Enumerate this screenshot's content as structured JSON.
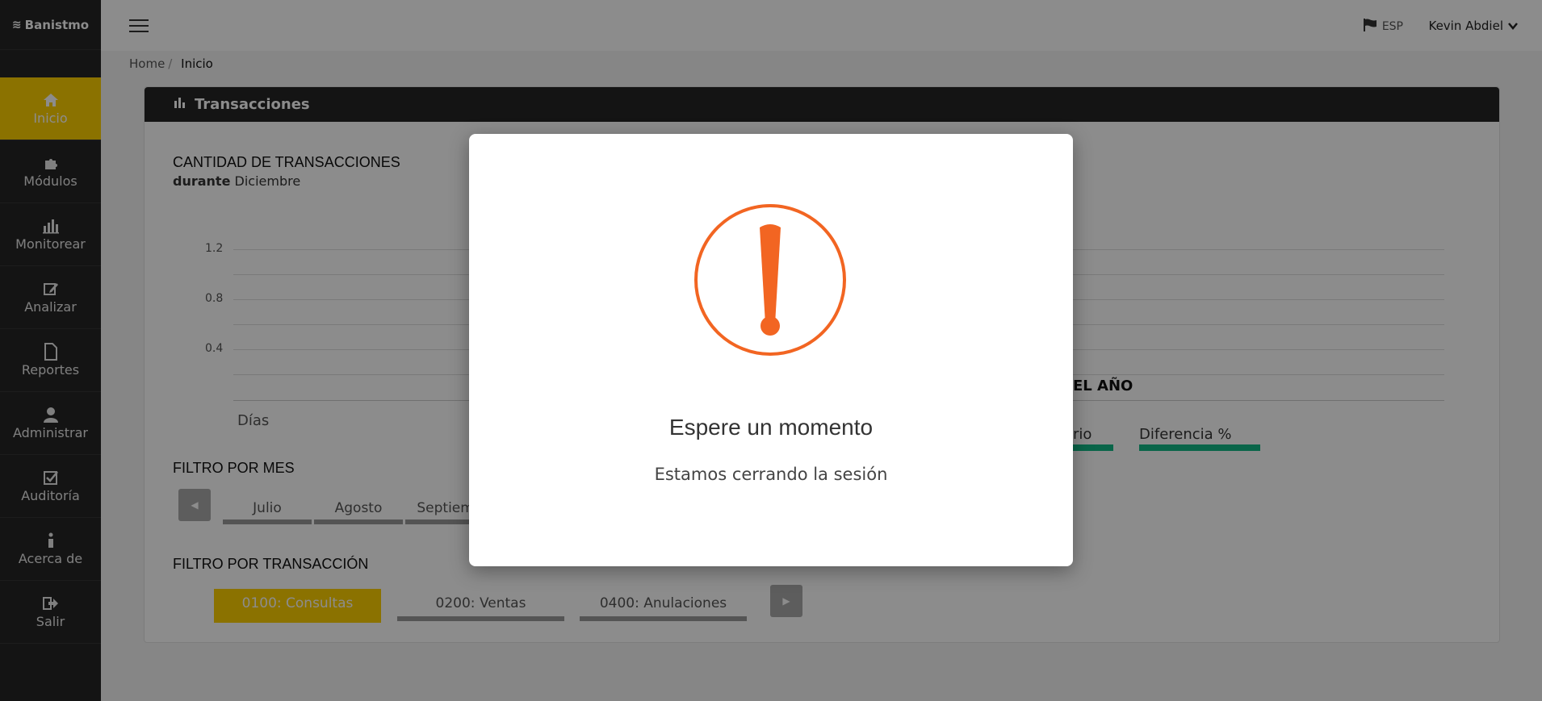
{
  "brand": {
    "name": "Banistmo"
  },
  "sidebar": {
    "items": [
      {
        "label": "Inicio",
        "icon": "home-icon",
        "active": true
      },
      {
        "label": "Módulos",
        "icon": "puzzle-icon"
      },
      {
        "label": "Monitorear",
        "icon": "bar-chart-icon"
      },
      {
        "label": "Analizar",
        "icon": "edit-icon"
      },
      {
        "label": "Reportes",
        "icon": "file-icon"
      },
      {
        "label": "Administrar",
        "icon": "user-icon"
      },
      {
        "label": "Auditoría",
        "icon": "check-square-icon"
      },
      {
        "label": "Acerca de",
        "icon": "info-icon"
      },
      {
        "label": "Salir",
        "icon": "logout-icon"
      }
    ]
  },
  "topbar": {
    "language": "ESP",
    "user": "Kevin Abdiel"
  },
  "breadcrumb": {
    "home": "Home",
    "sep": "/",
    "current": "Inicio"
  },
  "card": {
    "title": "Transacciones",
    "section_title": "CANTIDAD DE TRANSACCIONES",
    "subtitle_bold": "durante",
    "subtitle_month": "Diciembre",
    "y_ticks": [
      "1.2",
      "0.8",
      "0.4"
    ],
    "x_label": "Días",
    "year_title_partial": "EL AÑO",
    "year_col_partial": "rio",
    "year_col_diff": "Diferencia %",
    "month_filter_title": "FILTRO POR MES",
    "months": [
      "Julio",
      "Agosto",
      "Septiemb"
    ],
    "trans_filter_title": "FILTRO POR TRANSACCIÓN",
    "transactions": [
      "0100: Consultas",
      "0200: Ventas",
      "0400: Anulaciones"
    ]
  },
  "modal": {
    "title": "Espere un momento",
    "text": "Estamos cerrando la sesión",
    "icon": "warning-exclamation-icon",
    "accent": "#f26522"
  },
  "colors": {
    "brand_yellow": "#fdd000",
    "sidebar": "#262626",
    "diff_bar": "#12b886"
  }
}
